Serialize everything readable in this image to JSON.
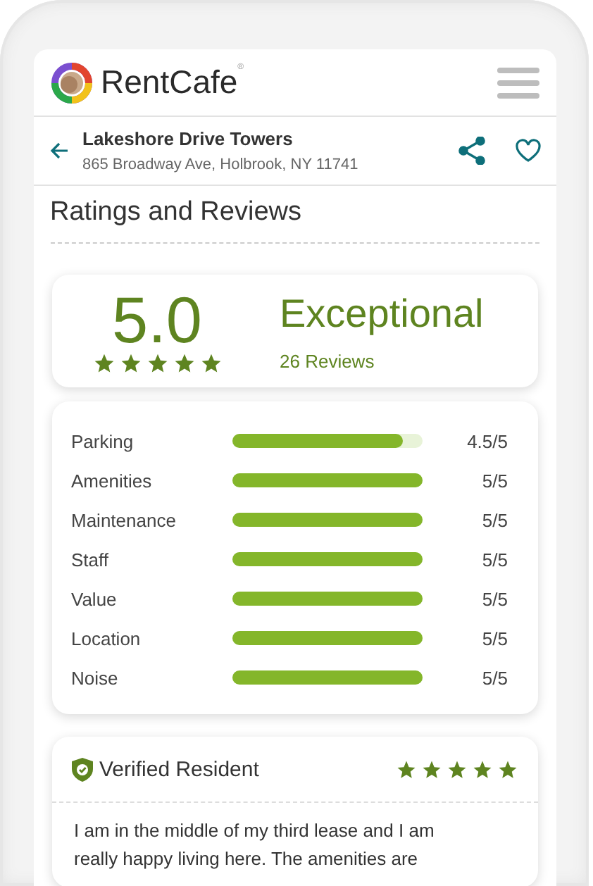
{
  "header": {
    "brand": "RentCafe",
    "brand_mark": "®"
  },
  "property": {
    "name": "Lakeshore Drive Towers",
    "address": "865 Broadway Ave, Holbrook, NY 11741"
  },
  "section_title": "Ratings and Reviews",
  "summary": {
    "score": "5.0",
    "stars": 5,
    "verdict": "Exceptional",
    "count": "26 Reviews"
  },
  "ratings": [
    {
      "label": "Parking",
      "level": 0.9,
      "reading": "4.5/5"
    },
    {
      "label": "Amenities",
      "level": 1,
      "reading": "5/5"
    },
    {
      "label": "Maintenance",
      "level": 1,
      "reading": "5/5"
    },
    {
      "label": "Staff",
      "level": 1,
      "reading": "5/5"
    },
    {
      "label": "Value",
      "level": 1,
      "reading": "5/5"
    },
    {
      "label": "Location",
      "level": 1,
      "reading": "5/5"
    },
    {
      "label": "Noise",
      "level": 1,
      "reading": "5/5"
    }
  ],
  "review": {
    "author": "Verified Resident",
    "verified": true,
    "stars": 5,
    "lines": [
      "I am in the middle of my third lease and I am",
      "really happy living here. The amenities are"
    ]
  }
}
